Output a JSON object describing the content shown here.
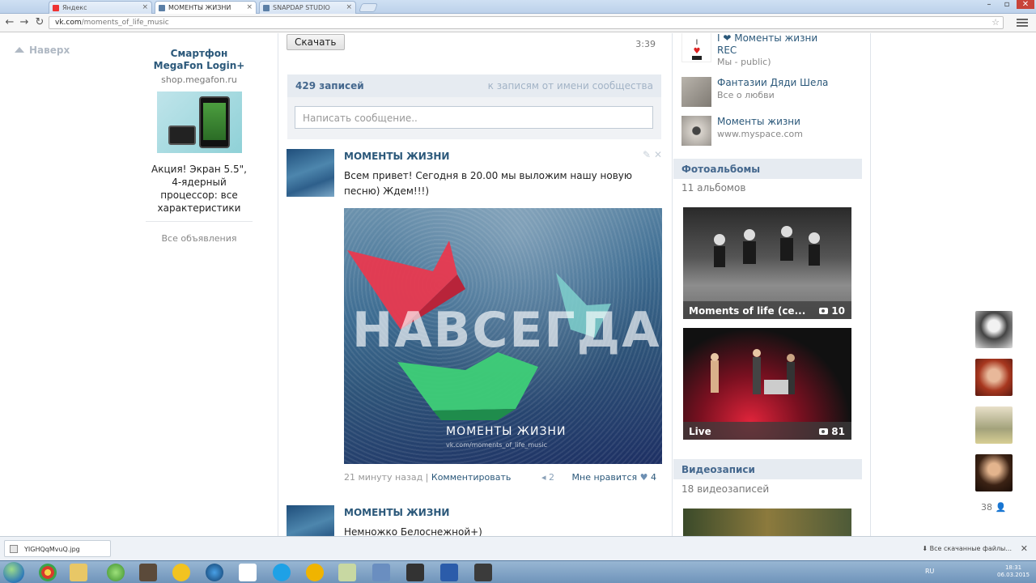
{
  "browser": {
    "tabs": [
      {
        "title": "Яндекс"
      },
      {
        "title": "МОМЕНТЫ ЖИЗНИ"
      },
      {
        "title": "SNAPDAP STUDIO"
      }
    ],
    "url_host": "vk.com",
    "url_path": "/moments_of_life_music"
  },
  "nav": {
    "back_to_top": "Наверх"
  },
  "ad": {
    "title": "Смартфон MegaFon Login+",
    "site": "shop.megafon.ru",
    "text": "Акция! Экран 5.5\", 4-ядерный процессор: все характеристики",
    "all_ads": "Все объявления"
  },
  "audio": {
    "download_label": "Скачать",
    "duration": "3:39"
  },
  "wall": {
    "count": "429 записей",
    "toggle": "к записям от имени сообщества",
    "input_placeholder": "Написать сообщение.."
  },
  "posts": [
    {
      "author": "МОМЕНТЫ ЖИЗНИ",
      "text": "Всем привет! Сегодня в 20.00 мы выложим нашу новую песню) Ждем!!!)",
      "image_big_text": "НАВСЕГДА",
      "image_caption": "МОМЕНТЫ ЖИЗНИ",
      "image_url": "vk.com/moments_of_life_music",
      "time": "21 минуту назад",
      "comment_label": "Комментировать",
      "shares": "2",
      "like_label": "Мне нравится",
      "likes": "4"
    },
    {
      "author": "МОМЕНТЫ ЖИЗНИ",
      "text": "Немножко Белоснежной+)"
    }
  ],
  "groups": [
    {
      "name": "I ❤ Моменты жизни REC",
      "sub": "Мы - public)"
    },
    {
      "name": "Фантазии Дяди Шела",
      "sub": "Все о любви"
    },
    {
      "name": "Моменты жизни",
      "sub": "www.myspace.com"
    }
  ],
  "albums_block": {
    "title": "Фотоальбомы",
    "count": "11 альбомов",
    "albums": [
      {
        "name": "Moments of life (се...",
        "count": "10"
      },
      {
        "name": "Live",
        "count": "81"
      }
    ]
  },
  "videos_block": {
    "title": "Видеозаписи",
    "count": "18 видеозаписей"
  },
  "friends": {
    "online_count": "38"
  },
  "downloads": {
    "file": "YIGHQqMvuQ.jpg",
    "show_all": "Все скачанные файлы..."
  },
  "taskbar": {
    "lang": "RU",
    "time": "18:31",
    "date": "06.03.2015"
  },
  "colors": {
    "vk_link": "#2b587a",
    "vk_header_bg": "#e6ebf1",
    "vk_header_text": "#45688e"
  }
}
